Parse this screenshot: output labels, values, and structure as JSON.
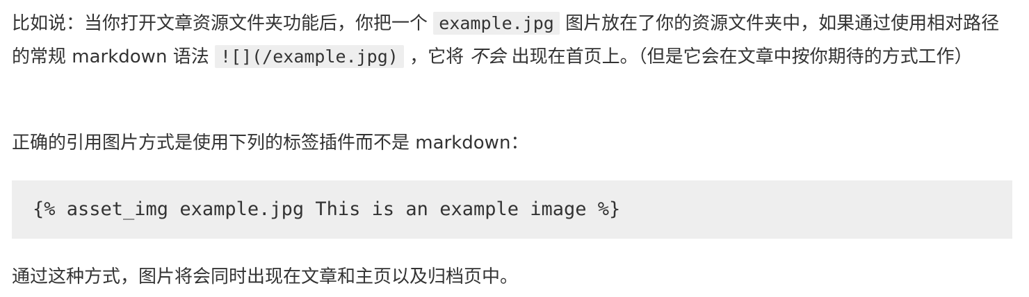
{
  "article": {
    "para1": {
      "text_a": "比如说：当你打开文章资源文件夹功能后，你把一个 ",
      "code_a": "example.jpg",
      "text_b": " 图片放在了你的资源文件夹中，如果通过使用相对路径的常规 markdown 语法 ",
      "code_b": "![](/example.jpg)",
      "text_c": " ，它将 ",
      "emph": "不会",
      "text_d": " 出现在首页上。（但是它会在文章中按你期待的方式工作）"
    },
    "para2": "正确的引用图片方式是使用下列的标签插件而不是 markdown：",
    "code_block": "{% asset_img example.jpg This is an example image %}",
    "para3": "通过这种方式，图片将会同时出现在文章和主页以及归档页中。"
  }
}
